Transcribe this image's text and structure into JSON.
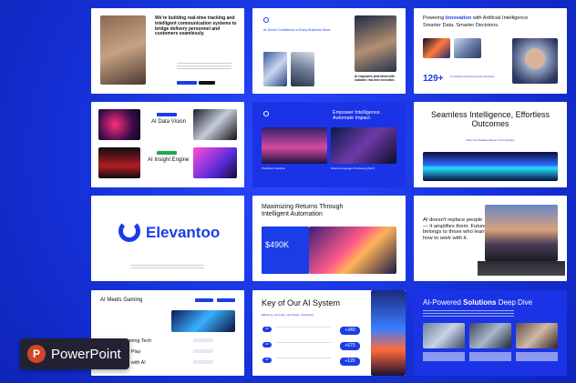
{
  "s1": {
    "text": "We're building real-time tracking and intelligent communication systems to bridge delivery personnel and customers seamlessly."
  },
  "s2": {
    "title": "AI-Driven Confidence in Every Business Move",
    "caption": "AI empowers bold ideas with scalable, real-time execution."
  },
  "s3": {
    "title_a": "Powering ",
    "title_b": "Innovation",
    "title_c": " with Artificial Intelligence",
    "subtitle": "Smarter Data. Smarter Decisions.",
    "stat": "129+",
    "stat_label": "AI solutions delivered across industries"
  },
  "s4": {
    "h1": "AI Data Vision",
    "h2": "AI Insight Engine"
  },
  "s5": {
    "title": "Empower Intelligence. Automate Impact.",
    "label1": "Predictive Analytics",
    "label2": "Natural Language Processing (NLP)"
  },
  "s6": {
    "title": "Seamless Intelligence, Effortless Outcomes",
    "subtitle": "Real-Time Reliable Data at Your Fingertips"
  },
  "s7": {
    "brand": "Elevantoo"
  },
  "s8": {
    "title": "Maximizing Returns Through Intelligent Automation",
    "value": "$490K"
  },
  "s9": {
    "title": "AI doesn't replace people — it amplifies them. Future belongs to those who learn how to work with it."
  },
  "s10": {
    "title": "AI Meets Gaming",
    "row1": "Next-Gen Gaming Tech",
    "row2": "The Future of Play",
    "row3": "Evolving Play with AI"
  },
  "s11": {
    "title": "Key of Our AI System",
    "subtitle": "Efficiency, Accuracy, and Scale—Delivered",
    "v1": "+340",
    "v2": "+670",
    "v3": "+120",
    "n1": "01",
    "n2": "02",
    "n3": "03"
  },
  "s12": {
    "title_a": "AI-Powered ",
    "title_b": "Solutions",
    "title_c": " Deep Dive"
  },
  "badge": {
    "label": "PowerPoint",
    "letter": "P"
  },
  "colors": {
    "accent": "#1a3de8",
    "background": "#1530d6"
  }
}
